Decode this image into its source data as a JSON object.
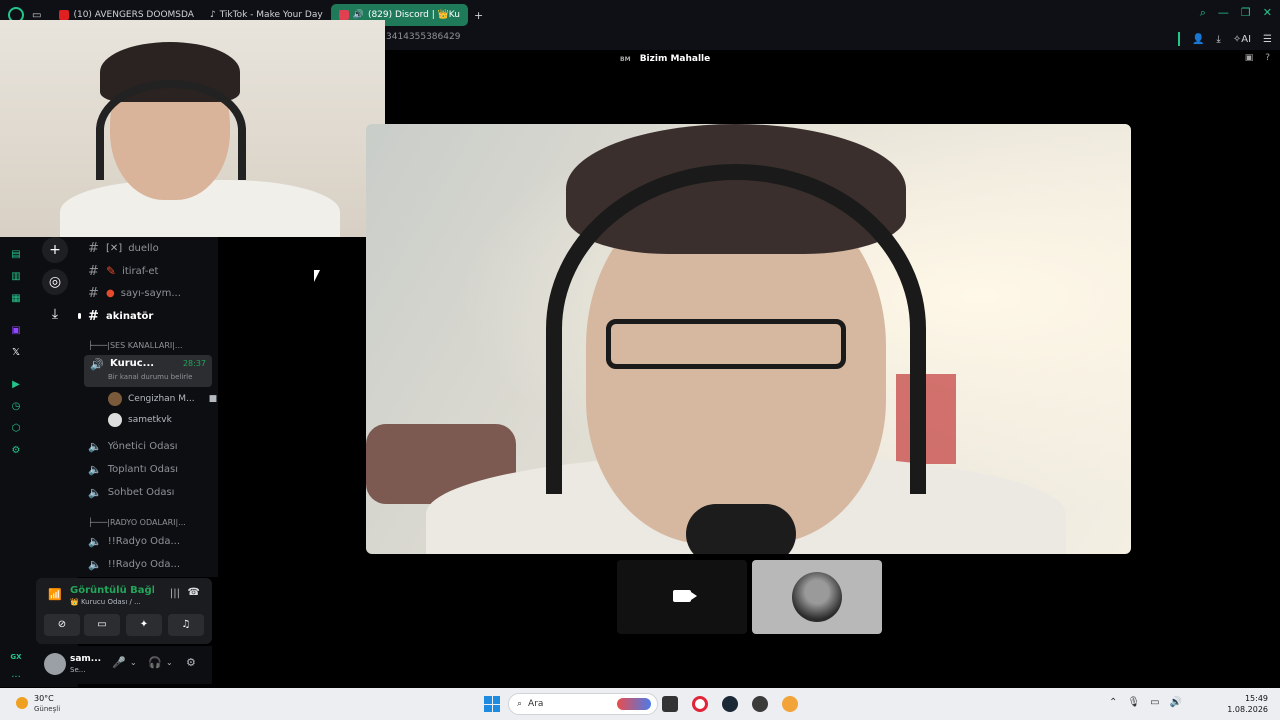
{
  "browser": {
    "tabs": [
      {
        "label": "(10) AVENGERS DOOMSDA",
        "fav_color": "#e02020"
      },
      {
        "label": "TikTok - Make Your Day",
        "fav_color": "#ffffff"
      },
      {
        "label": "(829) Discord | 👑Ku",
        "fav_color": "#e04050"
      }
    ],
    "new_tab": "+",
    "url_fragment": "3414355386429",
    "ai_label": "AI"
  },
  "call": {
    "server_tag": "BM",
    "title": "Bizim Mahalle"
  },
  "channels": {
    "text": [
      {
        "name": "duello",
        "deco": "[✕]"
      },
      {
        "name": "itiraf-et",
        "deco": ""
      },
      {
        "name": "sayı-saym...",
        "deco": ""
      },
      {
        "name": "akinatör",
        "deco": ""
      }
    ],
    "voice_category": "├───|SES KANALLARI|...",
    "active_voice": {
      "name": "Kuruc...",
      "time": "28:37",
      "status": "Bir kanal durumu belirle"
    },
    "members": [
      {
        "name": "Cengizhan M..."
      },
      {
        "name": "sametkvk"
      }
    ],
    "voice_channels": [
      {
        "name": "Yönetici Odası"
      },
      {
        "name": "Toplantı Odası"
      },
      {
        "name": "Sohbet Odası"
      }
    ],
    "radio_category": "├───|RADYO ODALARI|...",
    "radio_channels": [
      {
        "name": "!!Radyo Oda..."
      },
      {
        "name": "!!Radyo Oda..."
      }
    ]
  },
  "voice_panel": {
    "connection": "Görüntülü Bağlantı",
    "subtitle": "👑 Kurucu Odası / ..."
  },
  "user": {
    "name": "sam...",
    "status": "Se..."
  },
  "opera_sidebar": {
    "gx_label": "GX",
    "more": "..."
  },
  "taskbar": {
    "temp": "30°C",
    "weather": "Güneşli",
    "search_placeholder": "Ara",
    "time": "15:49",
    "date": "1.08.2026"
  }
}
